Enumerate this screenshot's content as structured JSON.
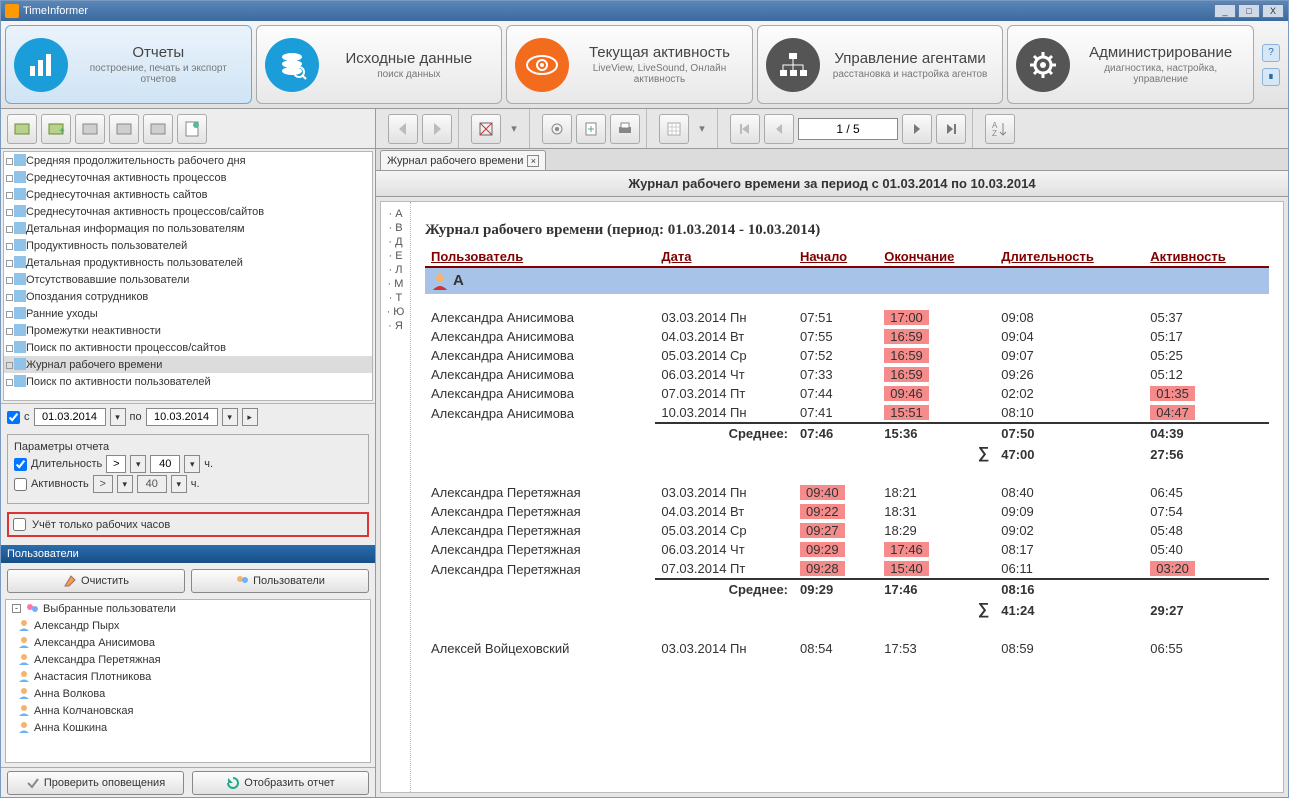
{
  "app": {
    "title": "TimeInformer"
  },
  "winbtns": {
    "min": "_",
    "max": "□",
    "close": "X"
  },
  "nav": [
    {
      "title": "Отчеты",
      "sub": "построение, печать и экспорт отчетов",
      "icon": "bars",
      "color": "ni-blue",
      "active": true
    },
    {
      "title": "Исходные данные",
      "sub": "поиск данных",
      "icon": "db",
      "color": "ni-blue",
      "active": false
    },
    {
      "title": "Текущая активность",
      "sub": "LiveView, LiveSound, Онлайн активность",
      "icon": "eye",
      "color": "ni-orange",
      "active": false
    },
    {
      "title": "Управление агентами",
      "sub": "расстановка и настройка агентов",
      "icon": "net",
      "color": "ni-dark",
      "active": false
    },
    {
      "title": "Администрирование",
      "sub": "диагностика, настройка, управление",
      "icon": "gear",
      "color": "ni-dark",
      "active": false
    }
  ],
  "sideicons": {
    "help": "?",
    "chart": "∎"
  },
  "tree": [
    "Средняя продолжительность рабочего дня",
    "Среднесуточная активность процессов",
    "Среднесуточная активность сайтов",
    "Среднесуточная активность процессов/сайтов",
    "Детальная информация по пользователям",
    "Продуктивность пользователей",
    "Детальная продуктивность пользователей",
    "Отсутствовавшие пользователи",
    "Опоздания сотрудников",
    "Ранние уходы",
    "Промежутки неактивности",
    "Поиск по активности процессов/сайтов",
    "Журнал рабочего времени",
    "Поиск по активности пользователей"
  ],
  "tree_selected_index": 12,
  "daterange": {
    "from_lbl": "с",
    "from": "01.03.2014",
    "to_lbl": "по",
    "to": "10.03.2014"
  },
  "params": {
    "legend": "Параметры отчета",
    "dur_lbl": "Длительность",
    "dur_op": ">",
    "dur_val": "40",
    "dur_unit": "ч.",
    "act_lbl": "Активность",
    "act_op": ">",
    "act_val": "40",
    "act_unit": "ч.",
    "workhours_lbl": "Учёт только рабочих часов"
  },
  "users_hdr": "Пользователи",
  "btn_clear": "Очистить",
  "btn_users": "Пользователи",
  "selected_users_root": "Выбранные пользователи",
  "selected_users": [
    "Александр Пырх",
    "Александра Анисимова",
    "Александра Перетяжная",
    "Анастасия Плотникова",
    "Анна Волкова",
    "Анна Колчановская",
    "Анна Кошкина"
  ],
  "btn_check": "Проверить оповещения",
  "btn_show": "Отобразить отчет",
  "pager": {
    "cur": "1 / 5"
  },
  "alphabet": [
    "А",
    "В",
    "Д",
    "Е",
    "Л",
    "М",
    "Т",
    "Ю",
    "Я"
  ],
  "tab_label": "Журнал рабочего времени",
  "report_header": "Журнал рабочего времени за период с 01.03.2014 по 10.03.2014",
  "report_title": "Журнал рабочего времени (период: 01.03.2014 - 10.03.2014)",
  "cols": {
    "user": "Пользователь",
    "date": "Дата",
    "start": "Начало",
    "end": "Окончание",
    "dur": "Длительность",
    "act": "Активность"
  },
  "group1_letter": "А",
  "avg_lbl": "Среднее:",
  "sigma": "∑",
  "rows1": [
    {
      "u": "Александра Анисимова",
      "d": "03.03.2014 Пн",
      "s": "07:51",
      "e": "17:00",
      "er": true,
      "dur": "09:08",
      "a": "05:37"
    },
    {
      "u": "Александра Анисимова",
      "d": "04.03.2014 Вт",
      "s": "07:55",
      "e": "16:59",
      "er": true,
      "dur": "09:04",
      "a": "05:17"
    },
    {
      "u": "Александра Анисимова",
      "d": "05.03.2014 Ср",
      "s": "07:52",
      "e": "16:59",
      "er": true,
      "dur": "09:07",
      "a": "05:25"
    },
    {
      "u": "Александра Анисимова",
      "d": "06.03.2014 Чт",
      "s": "07:33",
      "e": "16:59",
      "er": true,
      "dur": "09:26",
      "a": "05:12"
    },
    {
      "u": "Александра Анисимова",
      "d": "07.03.2014 Пт",
      "s": "07:44",
      "e": "09:46",
      "er": true,
      "dur": "02:02",
      "a": "01:35",
      "ar": true
    },
    {
      "u": "Александра Анисимова",
      "d": "10.03.2014 Пн",
      "s": "07:41",
      "e": "15:51",
      "er": true,
      "dur": "08:10",
      "a": "04:47",
      "ar": true
    }
  ],
  "avg1": {
    "s": "07:46",
    "e": "15:36",
    "dur": "07:50",
    "a": "04:39"
  },
  "sum1": {
    "dur": "47:00",
    "a": "27:56"
  },
  "rows2": [
    {
      "u": "Александра Перетяжная",
      "d": "03.03.2014 Пн",
      "s": "09:40",
      "sr": true,
      "e": "18:21",
      "dur": "08:40",
      "a": "06:45"
    },
    {
      "u": "Александра Перетяжная",
      "d": "04.03.2014 Вт",
      "s": "09:22",
      "sr": true,
      "e": "18:31",
      "dur": "09:09",
      "a": "07:54"
    },
    {
      "u": "Александра Перетяжная",
      "d": "05.03.2014 Ср",
      "s": "09:27",
      "sr": true,
      "e": "18:29",
      "dur": "09:02",
      "a": "05:48"
    },
    {
      "u": "Александра Перетяжная",
      "d": "06.03.2014 Чт",
      "s": "09:29",
      "sr": true,
      "e": "17:46",
      "er": true,
      "dur": "08:17",
      "a": "05:40"
    },
    {
      "u": "Александра Перетяжная",
      "d": "07.03.2014 Пт",
      "s": "09:28",
      "sr": true,
      "e": "15:40",
      "er": true,
      "dur": "06:11",
      "a": "03:20",
      "ar": true
    }
  ],
  "avg2": {
    "s": "09:29",
    "e": "17:46",
    "dur": "08:16",
    "a": ""
  },
  "sum2": {
    "dur": "41:24",
    "a": "29:27"
  },
  "rows3": [
    {
      "u": "Алексей Войцеховский",
      "d": "03.03.2014 Пн",
      "s": "08:54",
      "e": "17:53",
      "dur": "08:59",
      "a": "06:55"
    }
  ]
}
